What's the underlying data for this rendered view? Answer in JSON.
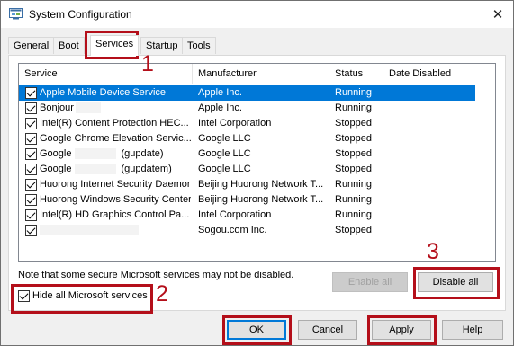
{
  "window": {
    "title": "System Configuration",
    "close_glyph": "✕"
  },
  "tabs": [
    {
      "label": "General"
    },
    {
      "label": "Boot"
    },
    {
      "label": "Services",
      "active": true
    },
    {
      "label": "Startup"
    },
    {
      "label": "Tools"
    }
  ],
  "services": {
    "columns": [
      "Service",
      "Manufacturer",
      "Status",
      "Date Disabled"
    ],
    "rows": [
      {
        "name": "Apple Mobile Device Service",
        "manufacturer": "Apple Inc.",
        "status": "Running",
        "checked": true,
        "selected": true
      },
      {
        "name": "Bonjour",
        "manufacturer": "Apple Inc.",
        "status": "Running",
        "checked": true
      },
      {
        "name": "Intel(R) Content Protection HEC...",
        "manufacturer": "Intel Corporation",
        "status": "Stopped",
        "checked": true
      },
      {
        "name": "Google Chrome Elevation Servic...",
        "manufacturer": "Google LLC",
        "status": "Stopped",
        "checked": true
      },
      {
        "name": "Google",
        "name_suffix": "(gupdate)",
        "manufacturer": "Google LLC",
        "status": "Stopped",
        "checked": true
      },
      {
        "name": "Google",
        "name_suffix": "(gupdatem)",
        "manufacturer": "Google LLC",
        "status": "Stopped",
        "checked": true
      },
      {
        "name": "Huorong Internet Security Daemon",
        "manufacturer": "Beijing Huorong Network T...",
        "status": "Running",
        "checked": true
      },
      {
        "name": "Huorong Windows Security Center",
        "manufacturer": "Beijing Huorong Network T...",
        "status": "Running",
        "checked": true
      },
      {
        "name": "Intel(R) HD Graphics Control Pa...",
        "manufacturer": "Intel Corporation",
        "status": "Running",
        "checked": true
      },
      {
        "name": "",
        "manufacturer": "Sogou.com Inc.",
        "status": "Stopped",
        "checked": true
      }
    ]
  },
  "note": "Note that some secure Microsoft services may not be disabled.",
  "buttons": {
    "enable_all": "Enable all",
    "disable_all": "Disable all",
    "ok": "OK",
    "cancel": "Cancel",
    "apply": "Apply",
    "help": "Help"
  },
  "hide_ms": {
    "label": "Hide all Microsoft services",
    "checked": true
  },
  "annotations": {
    "step1": "1",
    "step2": "2",
    "step3": "3",
    "color": "#b40f1a"
  },
  "colors": {
    "selection": "#0078d7",
    "highlight_box": "#b40f1a"
  }
}
